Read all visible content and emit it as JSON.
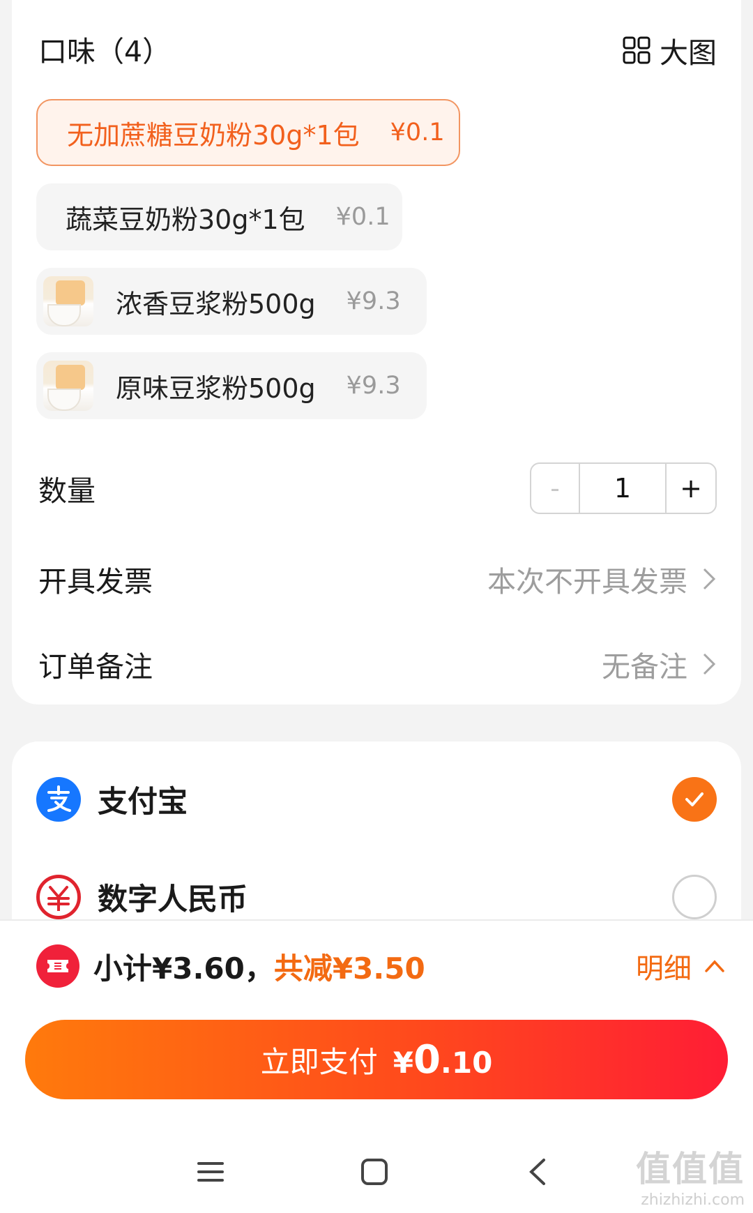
{
  "flavor": {
    "header": "口味（4）",
    "big_image_label": "大图",
    "options": [
      {
        "name": "无加蔗糖豆奶粉30g*1包",
        "price": "¥0.1",
        "selected": true,
        "has_thumb": false
      },
      {
        "name": "蔬菜豆奶粉30g*1包",
        "price": "¥0.1",
        "selected": false,
        "has_thumb": false
      },
      {
        "name": "浓香豆浆粉500g",
        "price": "¥9.3",
        "selected": false,
        "has_thumb": true
      },
      {
        "name": "原味豆浆粉500g",
        "price": "¥9.3",
        "selected": false,
        "has_thumb": true
      }
    ]
  },
  "quantity": {
    "label": "数量",
    "value": "1",
    "minus": "-",
    "plus": "+"
  },
  "invoice": {
    "label": "开具发票",
    "value": "本次不开具发票"
  },
  "remark": {
    "label": "订单备注",
    "value": "无备注"
  },
  "payment": {
    "methods": [
      {
        "name": "支付宝",
        "icon": "alipay-icon",
        "selected": true
      },
      {
        "name": "数字人民币",
        "icon": "ecny-icon",
        "selected": false
      }
    ]
  },
  "summary": {
    "subtotal": "小计¥3.60，",
    "saved": "共减¥3.50",
    "detail_label": "明细"
  },
  "pay_button": {
    "label": "立即支付",
    "currency": "¥",
    "amount_big": "0",
    "amount_small": ".10"
  },
  "watermark": {
    "brand": "值值值",
    "site": "zhizhizhi.com"
  },
  "colors": {
    "accent": "#f36a12",
    "alipay": "#1677ff",
    "ecny": "#e0242e",
    "coupon": "#f0213a"
  }
}
